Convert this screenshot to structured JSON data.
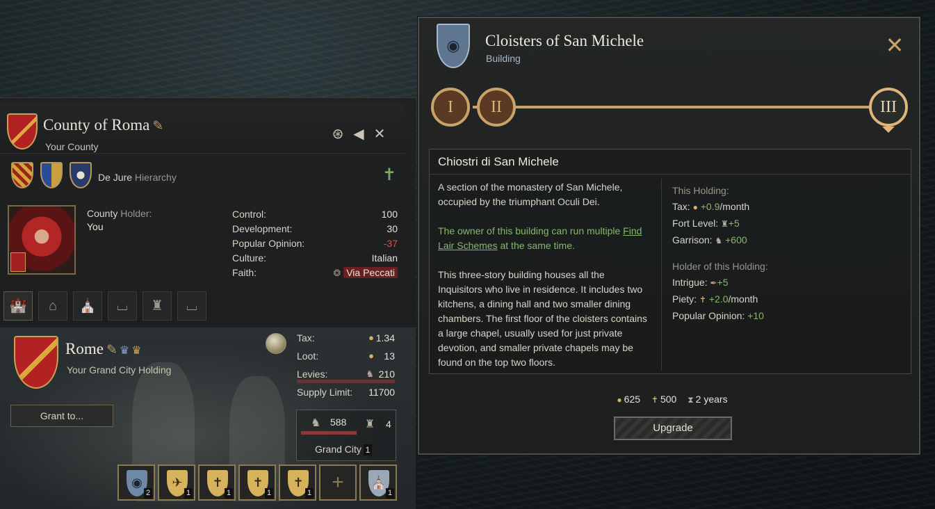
{
  "county": {
    "title": "County of Roma",
    "subtitle": "Your County",
    "dejure_label": "De Jure",
    "dejure_suffix": "Hierarchy",
    "holder_label": "County",
    "holder_label_suffix": "Holder:",
    "holder_name": "You",
    "stats": [
      {
        "label": "Control:",
        "value": "100"
      },
      {
        "label": "Development:",
        "value": "30"
      },
      {
        "label": "Popular Opinion:",
        "value": "-37"
      },
      {
        "label": "Culture:",
        "value": "Italian"
      },
      {
        "label": "Faith:",
        "value": "Via Peccati"
      }
    ],
    "icons": {
      "goto": "goto-icon",
      "back": "back-arrow-icon",
      "close": "close-icon",
      "quill": "quill-icon",
      "faith": "faith-icon"
    }
  },
  "holding": {
    "name": "Rome",
    "subtitle": "Your Grand City Holding",
    "grant_label": "Grant to...",
    "stats": [
      {
        "label": "Tax:",
        "value": "1.34"
      },
      {
        "label": "Loot:",
        "value": "13"
      },
      {
        "label": "Levies:",
        "value": "210"
      },
      {
        "label": "Supply Limit:",
        "value": "11700"
      }
    ],
    "garrison": "588",
    "fort_level": "4",
    "type": "Grand City",
    "type_count": "1",
    "slots": [
      {
        "num": "2"
      },
      {
        "num": "1"
      },
      {
        "num": "1"
      },
      {
        "num": "1"
      },
      {
        "num": "1"
      },
      {
        "num": ""
      },
      {
        "num": "1"
      }
    ]
  },
  "building": {
    "title": "Cloisters of San Michele",
    "subtitle": "Building",
    "levels": [
      "I",
      "II",
      "III"
    ],
    "current_level": 3,
    "local_name": "Chiostri di San Michele",
    "desc_1": "A section of the monastery of San Michele, occupied by the triumphant Oculi Dei.",
    "desc_2_pre": "The owner of this building can run multiple",
    "desc_2_link": "Find Lair Schemes",
    "desc_2_post": "at the same time.",
    "desc_3": "This three-story building houses all the Inquisitors who live in residence. It includes two kitchens, a dining hall and two smaller dining chambers. The first floor of the cloisters contains a large chapel, usually used for just private devotion, and smaller private chapels may be found on the top two floors.",
    "holding_section": "This Holding:",
    "holding_effects": [
      {
        "label": "Tax:",
        "value": "+0.9",
        "suffix": "/month"
      },
      {
        "label": "Fort Level:",
        "value": "+5",
        "suffix": ""
      },
      {
        "label": "Garrison:",
        "value": "+600",
        "suffix": ""
      }
    ],
    "holder_section": "Holder of this Holding:",
    "holder_effects": [
      {
        "label": "Intrigue:",
        "value": "+5",
        "suffix": ""
      },
      {
        "label": "Piety:",
        "value": "+2.0",
        "suffix": "/month"
      },
      {
        "label": "Popular Opinion:",
        "value": "+10",
        "suffix": ""
      }
    ],
    "cost_gold": "625",
    "cost_piety": "500",
    "cost_time": "2 years",
    "upgrade_label": "Upgrade"
  },
  "colors": {
    "accent_gold": "#c9a46a",
    "positive": "#86b86a",
    "negative": "#d8504a",
    "faith_bg": "#6a2020"
  }
}
